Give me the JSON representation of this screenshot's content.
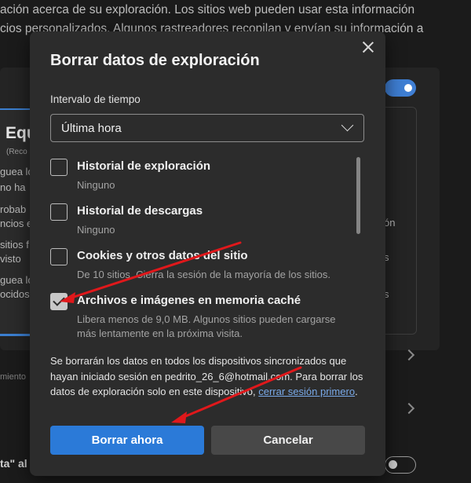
{
  "background": {
    "line1": "ación acerca de su exploración. Los sitios web pueden usar esta información",
    "line2": "cios personalizados. Algunos rastreadores recopilan y envían su información a",
    "card_heading": "Equ",
    "card_small": "(Reco",
    "side_lines": [
      "guea lo",
      "no ha",
      "robab",
      "ncios e",
      "sitios f",
      "visto",
      "guea lo",
      "ocidos"
    ],
    "right_fragments": [
      "ón",
      "s",
      "s"
    ],
    "faint_text": "miento",
    "bottom_text": "ta\" al"
  },
  "dialog": {
    "title": "Borrar datos de exploración",
    "time_range_label": "Intervalo de tiempo",
    "time_range_value": "Última hora",
    "items": [
      {
        "title": "Historial de exploración",
        "desc": "Ninguno",
        "checked": false
      },
      {
        "title": "Historial de descargas",
        "desc": "Ninguno",
        "checked": false
      },
      {
        "title": "Cookies y otros datos del sitio",
        "desc": "De 10 sitios. Cierra la sesión de la mayoría de los sitios.",
        "checked": false
      },
      {
        "title": "Archivos e imágenes en memoria caché",
        "desc": "Libera menos de 9,0 MB. Algunos sitios pueden cargarse más lentamente en la próxima visita.",
        "checked": true
      }
    ],
    "sync_text": "Se borrarán los datos en todos los dispositivos sincronizados que hayan iniciado sesión en pedrito_26_6@hotmail.com. Para borrar los datos de exploración solo en este dispositivo,",
    "sync_link": "cerrar sesión primero",
    "sync_end": ".",
    "primary_button": "Borrar ahora",
    "secondary_button": "Cancelar"
  },
  "colors": {
    "accent": "#2b7ad8",
    "annotation_arrow": "#e0181b",
    "link": "#79a9e8"
  }
}
